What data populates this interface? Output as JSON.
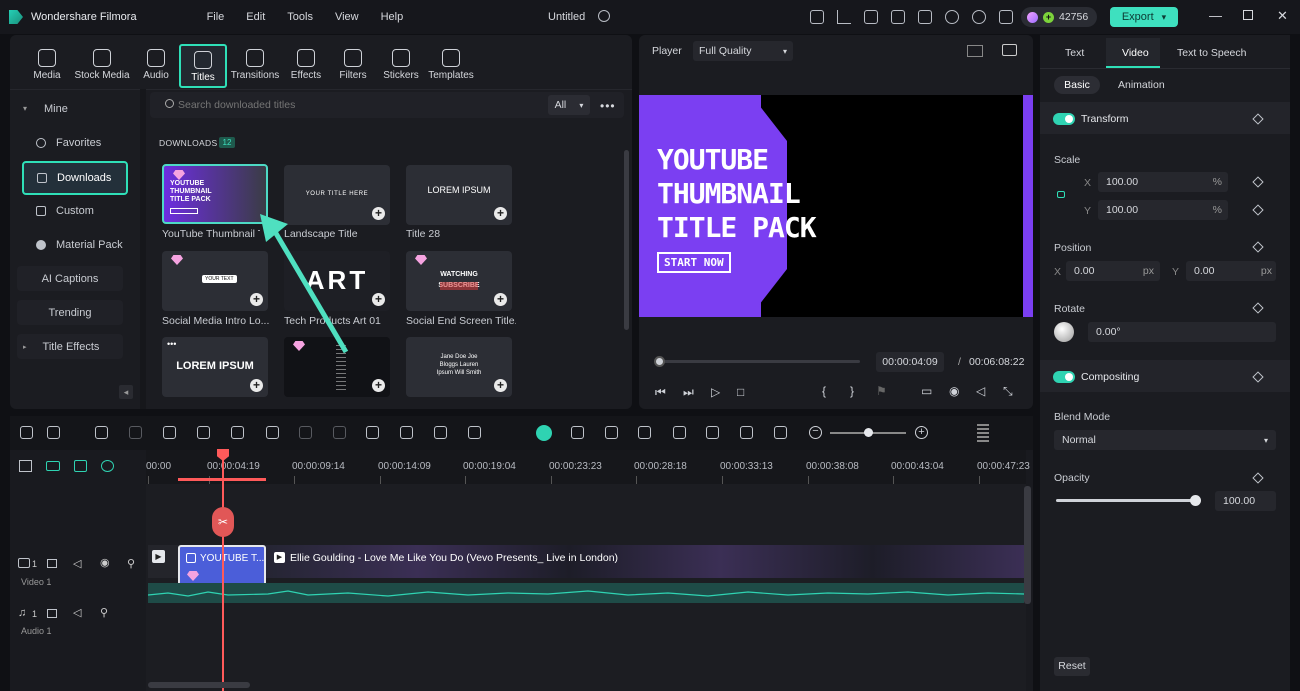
{
  "app": {
    "name": "Wondershare Filmora",
    "menus": [
      "File",
      "Edit",
      "Tools",
      "View",
      "Help"
    ],
    "project_title": "Untitled",
    "credits": "42756",
    "export_label": "Export"
  },
  "media_tabs": [
    {
      "label": "Media",
      "icon": "media-icon"
    },
    {
      "label": "Stock Media",
      "icon": "stock-media-icon"
    },
    {
      "label": "Audio",
      "icon": "music-note-icon"
    },
    {
      "label": "Titles",
      "icon": "titles-t-icon",
      "active": true
    },
    {
      "label": "Transitions",
      "icon": "transitions-icon"
    },
    {
      "label": "Effects",
      "icon": "effects-icon"
    },
    {
      "label": "Filters",
      "icon": "filters-icon"
    },
    {
      "label": "Stickers",
      "icon": "stickers-icon"
    },
    {
      "label": "Templates",
      "icon": "templates-icon"
    }
  ],
  "sidebar": {
    "items": [
      "Mine",
      "Favorites",
      "Downloads",
      "Custom",
      "Material Pack",
      "AI Captions",
      "Trending",
      "Title Effects"
    ]
  },
  "search": {
    "placeholder": "Search downloaded titles",
    "filter": "All"
  },
  "downloads": {
    "heading": "DOWNLOADS",
    "count": "12",
    "items": [
      {
        "title": "YouTube Thumbnail Ti...",
        "thumb_text": "YOUTUBE THUMBNAIL TITLE PACK"
      },
      {
        "title": "Landscape Title",
        "thumb_text": "YOUR TITLE HERE"
      },
      {
        "title": "Title 28",
        "thumb_text": "LOREM IPSUM"
      },
      {
        "title": "Social Media Intro Lo...",
        "thumb_text": "YOUR TEXT"
      },
      {
        "title": "Tech Products Art 01",
        "thumb_text": "ART"
      },
      {
        "title": "Social End Screen Title...",
        "thumb_text": "WATCHING SUBSCRIBE"
      },
      {
        "title": "",
        "thumb_text": "LOREM IPSUM"
      },
      {
        "title": "",
        "thumb_text": ""
      },
      {
        "title": "",
        "thumb_text": "Jane Doe Joe Bloggs Lauren Ipsum Will Smith"
      }
    ]
  },
  "player": {
    "label": "Player",
    "quality": "Full Quality",
    "preview_lines": [
      "YOUTUBE",
      "THUMBNAIL",
      "TITLE PACK"
    ],
    "preview_button": "START NOW",
    "current_time": "00:00:04:09",
    "separator": "/",
    "total_time": "00:06:08:22"
  },
  "timeline": {
    "ruler": [
      "00:00",
      "00:00:04:19",
      "00:00:09:14",
      "00:00:14:09",
      "00:00:19:04",
      "00:00:23:23",
      "00:00:28:18",
      "00:00:33:13",
      "00:00:38:08",
      "00:00:43:04",
      "00:00:47:23"
    ],
    "video_track": {
      "num": "1",
      "label": "Video 1"
    },
    "audio_track": {
      "num": "1",
      "label": "Audio 1"
    },
    "title_clip": "YOUTUBE T...",
    "video_clip": "Ellie Goulding - Love Me Like You Do (Vevo Presents_ Live in London)"
  },
  "inspector": {
    "tabs": [
      "Text",
      "Video",
      "Text to Speech"
    ],
    "subtabs": [
      "Basic",
      "Animation"
    ],
    "transform": "Transform",
    "scale": {
      "label": "Scale",
      "x_label": "X",
      "x": "100.00",
      "y_label": "Y",
      "y": "100.00",
      "unit": "%"
    },
    "position": {
      "label": "Position",
      "x_label": "X",
      "x": "0.00",
      "y_label": "Y",
      "y": "0.00",
      "unit": "px"
    },
    "rotate": {
      "label": "Rotate",
      "value": "0.00°"
    },
    "compositing": "Compositing",
    "blend_mode": {
      "label": "Blend Mode",
      "value": "Normal"
    },
    "opacity": {
      "label": "Opacity",
      "value": "100.00"
    },
    "reset": "Reset"
  },
  "colors": {
    "accent": "#2fe0b8",
    "purple": "#7b3ff2",
    "playhead": "#ff5a5a",
    "clip": "#4b5ed9"
  }
}
